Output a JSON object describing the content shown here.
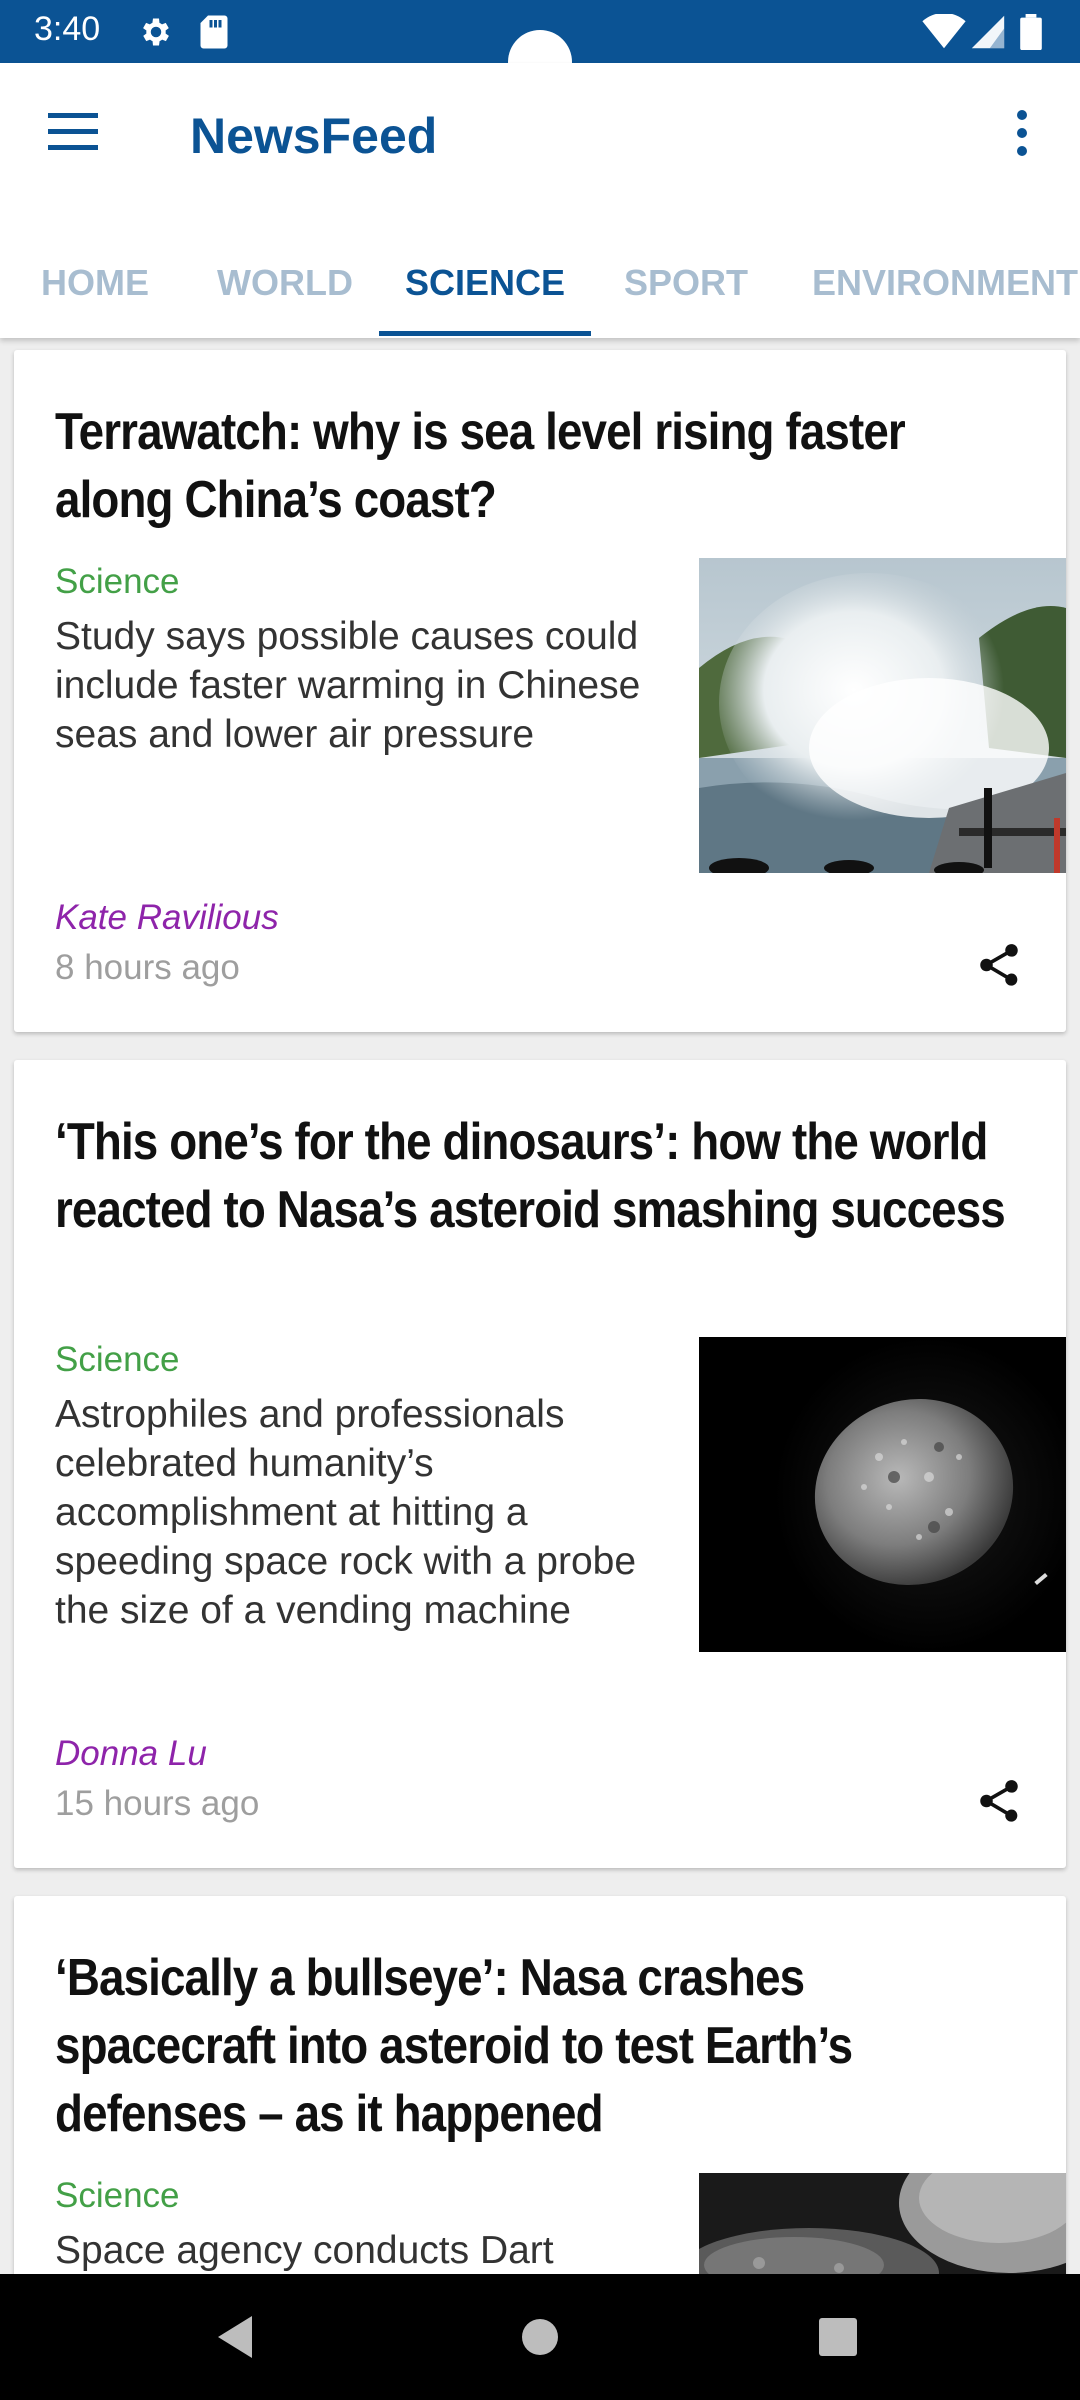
{
  "status_bar": {
    "time": "3:40",
    "icons": [
      "gear-icon",
      "sd-card-icon",
      "wifi-icon",
      "signal-icon",
      "battery-icon"
    ]
  },
  "app_bar": {
    "title": "NewsFeed",
    "menu_icon": "hamburger-menu-icon",
    "more_icon": "more-vert-icon"
  },
  "tabs": [
    {
      "label": "HOME",
      "active": false
    },
    {
      "label": "WORLD",
      "active": false
    },
    {
      "label": "SCIENCE",
      "active": true
    },
    {
      "label": "SPORT",
      "active": false
    },
    {
      "label": "ENVIRONMENT",
      "active": false
    }
  ],
  "articles": [
    {
      "headline": "Terrawatch: why is sea level rising faster along China’s coast?",
      "section": "Science",
      "standfirst": "Study says possible causes could include faster warming in Chinese seas and lower air pressure",
      "byline": "Kate Ravilious",
      "time": "8 hours ago",
      "image": "wave-crashing-coast-photo"
    },
    {
      "headline": "‘This one’s for the dinosaurs’: how the world reacted to Nasa’s asteroid smashing success",
      "section": "Science",
      "standfirst": "Astrophiles and professionals celebrated humanity’s accomplishment at hitting a speeding space rock with a probe the size of a vending machine",
      "byline": "Donna Lu",
      "time": "15 hours ago",
      "image": "asteroid-photo"
    },
    {
      "headline": "‘Basically a bullseye’: Nasa crashes spacecraft into asteroid to test Earth’s defenses – as it happened",
      "section": "Science",
      "standfirst": "Space agency conducts Dart",
      "image": "asteroid-surface-photo"
    }
  ],
  "nav_bar": {
    "icons": [
      "back-icon",
      "home-icon",
      "recents-icon"
    ]
  },
  "colors": {
    "primary": "#0b5394",
    "section": "#43a047",
    "byline": "#8e24aa",
    "tab_inactive": "#a8bdd0"
  }
}
